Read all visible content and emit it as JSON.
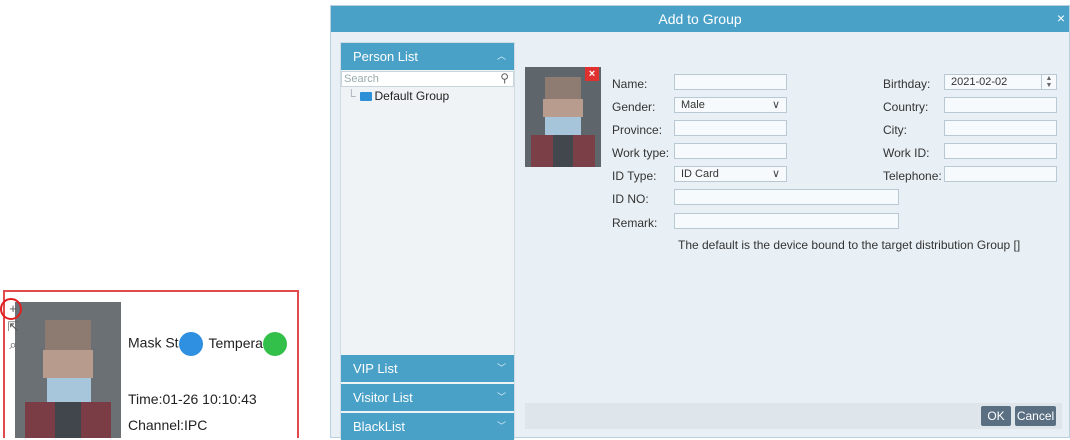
{
  "card": {
    "mask_label": "Mask St",
    "temp_label": "Tempera",
    "time": "Time:01-26 10:10:43",
    "channel": "Channel:IPC"
  },
  "dialog": {
    "title": "Add to Group",
    "close": "×",
    "panel": {
      "person_list": "Person List",
      "search_placeholder": "Search",
      "tree_item": "Default Group",
      "vip": "VIP List",
      "visitor": "Visitor List",
      "blacklist": "BlackList"
    },
    "form": {
      "name_label": "Name:",
      "name_value": "",
      "gender_label": "Gender:",
      "gender_value": "Male",
      "province_label": "Province:",
      "province_value": "",
      "worktype_label": "Work type:",
      "worktype_value": "",
      "idtype_label": "ID Type:",
      "idtype_value": "ID Card",
      "idno_label": "ID NO:",
      "idno_value": "",
      "remark_label": "Remark:",
      "remark_value": "",
      "birthday_label": "Birthday:",
      "birthday_value": "2021-02-02",
      "country_label": "Country:",
      "country_value": "",
      "city_label": "City:",
      "city_value": "",
      "workid_label": "Work ID:",
      "workid_value": "",
      "telephone_label": "Telephone:",
      "telephone_value": ""
    },
    "note": "The default is the device bound to the target distribution Group []",
    "ok": "OK",
    "cancel": "Cancel"
  }
}
